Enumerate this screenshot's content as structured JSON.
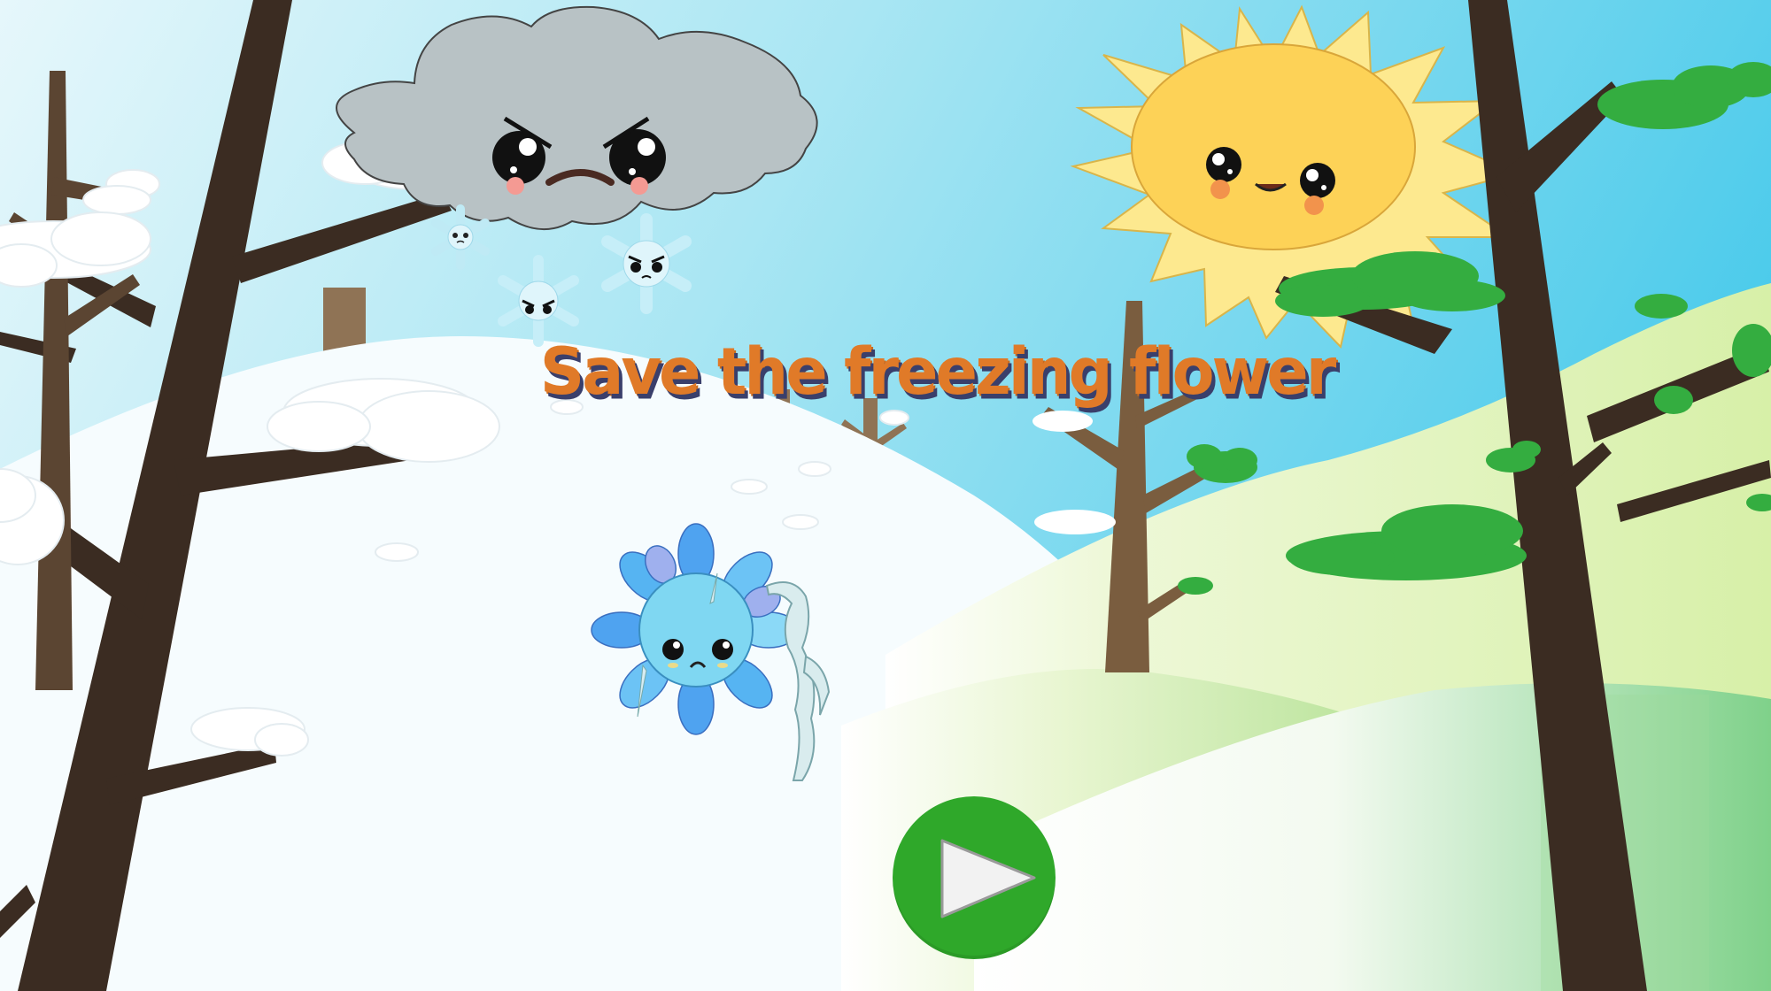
{
  "title": "Save the freezing flower",
  "play_button": {
    "icon": "play-icon"
  },
  "colors": {
    "sky_top": "#4fcbe8",
    "sky_bottom": "#d8f3fa",
    "title": "#e07a28",
    "title_shadow": "#3a3f6b",
    "play_button": "#2fa82a",
    "sun": "#fcd35a",
    "cloud": "#b7c1c4",
    "tree_dark": "#3b2c22",
    "tree_light": "#8f7355",
    "leaves": "#34ad40",
    "snow": "#ffffff",
    "flower": "#7fd7f2"
  },
  "characters": [
    "angry-cloud",
    "happy-sun",
    "sad-frozen-flower",
    "angry-snowflake"
  ]
}
